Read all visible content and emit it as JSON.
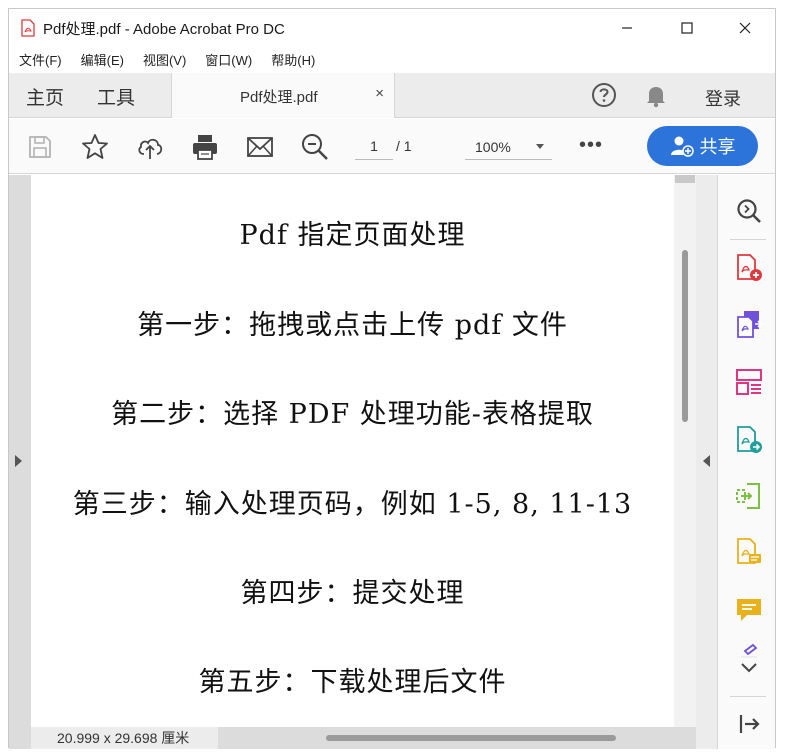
{
  "window": {
    "title": "Pdf处理.pdf - Adobe Acrobat Pro DC"
  },
  "menu": {
    "items": [
      "文件(F)",
      "编辑(E)",
      "视图(V)",
      "窗口(W)",
      "帮助(H)"
    ]
  },
  "tabs": {
    "home": "主页",
    "tools": "工具",
    "document": "Pdf处理.pdf",
    "close": "×",
    "login": "登录"
  },
  "toolbar": {
    "page_current": "1",
    "page_total": "/ 1",
    "zoom": "100%",
    "more": "•••",
    "share": "共享"
  },
  "document": {
    "lines": [
      "Pdf 指定页面处理",
      "第一步：拖拽或点击上传 pdf 文件",
      "第二步：选择 PDF 处理功能-表格提取",
      "第三步：输入处理页码，例如 1-5, 8, 11-13",
      "第四步：提交处理",
      "第五步：下载处理后文件"
    ]
  },
  "status": {
    "page_size": "20.999 x 29.698 厘米"
  },
  "colors": {
    "share_blue": "#2d74da",
    "acrobat_red": "#e0393e",
    "tool_purple": "#6f52d9",
    "tool_pink": "#e0357f",
    "tool_teal": "#1f9e9a",
    "tool_green": "#7bc043",
    "tool_yellow": "#e8b21c"
  },
  "icons": {
    "toolbar": [
      "save-icon",
      "bookmark-star-icon",
      "cloud-upload-icon",
      "print-icon",
      "email-icon",
      "zoom-out-icon"
    ],
    "right_panel": [
      "zoom-search-icon",
      "create-pdf-icon",
      "combine-files-icon",
      "organize-pages-icon",
      "export-pdf-icon",
      "edit-pdf-icon",
      "fill-sign-icon",
      "comment-icon",
      "more-tools-chevron-icon",
      "collapse-panel-icon"
    ]
  }
}
